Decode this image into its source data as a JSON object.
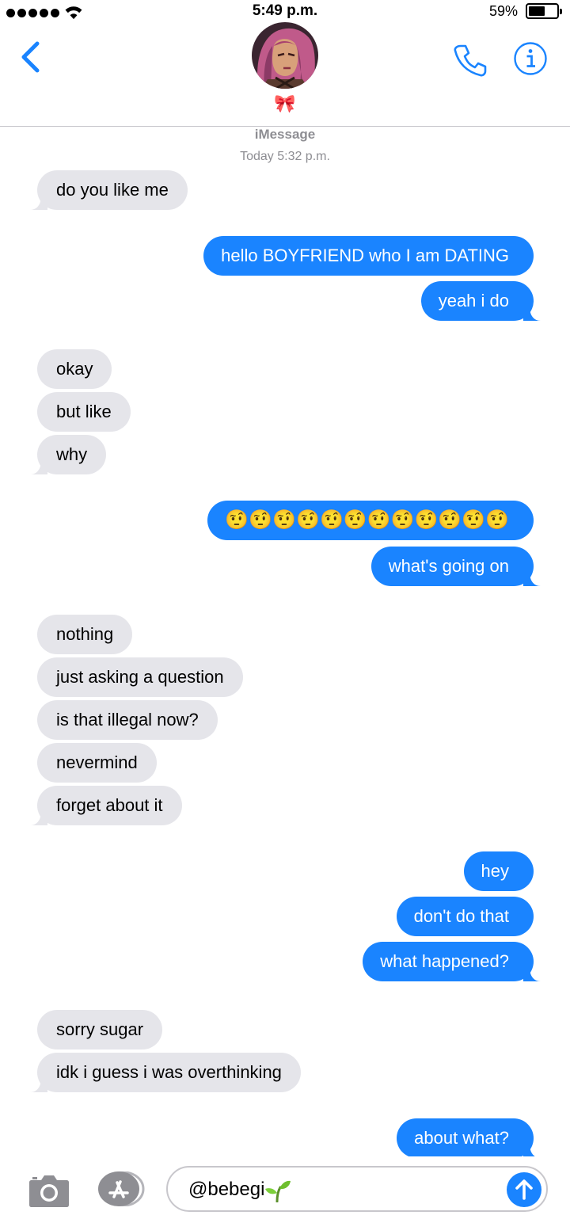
{
  "status_bar": {
    "time": "5:49 p.m.",
    "battery_percent": "59%",
    "battery_level": 0.59,
    "signal_bars": 5
  },
  "header": {
    "contact_name": "🎀",
    "back_icon": "chevron-left-icon",
    "call_icon": "phone-icon",
    "info_icon": "info-icon"
  },
  "conversation": {
    "service": "iMessage",
    "timestamp": "Today 5:32 p.m.",
    "messages": [
      {
        "from": "them",
        "text": "do you like me"
      },
      {
        "from": "me",
        "text": "hello BOYFRIEND who I am DATING"
      },
      {
        "from": "me",
        "text": "yeah i do"
      },
      {
        "from": "them",
        "text": "okay"
      },
      {
        "from": "them",
        "text": "but like"
      },
      {
        "from": "them",
        "text": "why"
      },
      {
        "from": "me",
        "text": "🤨🤨🤨🤨🤨🤨🤨🤨🤨🤨🤨🤨"
      },
      {
        "from": "me",
        "text": "what's going on"
      },
      {
        "from": "them",
        "text": "nothing"
      },
      {
        "from": "them",
        "text": "just asking a question"
      },
      {
        "from": "them",
        "text": "is that illegal now?"
      },
      {
        "from": "them",
        "text": "nevermind"
      },
      {
        "from": "them",
        "text": "forget about it"
      },
      {
        "from": "me",
        "text": "hey"
      },
      {
        "from": "me",
        "text": "don't do that"
      },
      {
        "from": "me",
        "text": "what happened?"
      },
      {
        "from": "them",
        "text": "sorry sugar"
      },
      {
        "from": "them",
        "text": "idk i guess i was overthinking"
      },
      {
        "from": "me",
        "text": "about what?"
      }
    ]
  },
  "composer": {
    "input_value": "@bebegi",
    "input_emoji": "seedling",
    "camera_icon": "camera-icon",
    "apps_icon": "app-store-icon",
    "send_icon": "arrow-up-icon"
  },
  "colors": {
    "sent_bubble": "#1a84ff",
    "received_bubble": "#e5e5ea",
    "accent": "#1a84ff",
    "meta_text": "#8e8e93"
  }
}
